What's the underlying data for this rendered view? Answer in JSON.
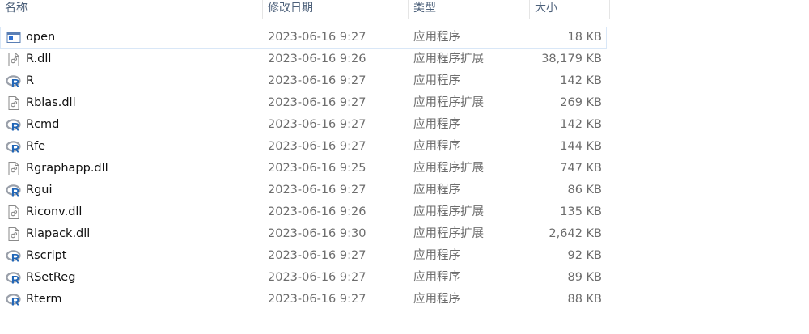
{
  "columns": {
    "name": "名称",
    "date": "修改日期",
    "type": "类型",
    "size": "大小"
  },
  "files": [
    {
      "name": "open",
      "date": "2023-06-16 9:27",
      "type": "应用程序",
      "size": "18 KB",
      "icon": "app-window-icon",
      "selected": true
    },
    {
      "name": "R.dll",
      "date": "2023-06-16 9:26",
      "type": "应用程序扩展",
      "size": "38,179 KB",
      "icon": "dll-file-icon"
    },
    {
      "name": "R",
      "date": "2023-06-16 9:27",
      "type": "应用程序",
      "size": "142 KB",
      "icon": "r-logo-icon"
    },
    {
      "name": "Rblas.dll",
      "date": "2023-06-16 9:27",
      "type": "应用程序扩展",
      "size": "269 KB",
      "icon": "dll-file-icon"
    },
    {
      "name": "Rcmd",
      "date": "2023-06-16 9:27",
      "type": "应用程序",
      "size": "142 KB",
      "icon": "r-logo-icon"
    },
    {
      "name": "Rfe",
      "date": "2023-06-16 9:27",
      "type": "应用程序",
      "size": "144 KB",
      "icon": "r-logo-icon"
    },
    {
      "name": "Rgraphapp.dll",
      "date": "2023-06-16 9:25",
      "type": "应用程序扩展",
      "size": "747 KB",
      "icon": "dll-file-icon"
    },
    {
      "name": "Rgui",
      "date": "2023-06-16 9:27",
      "type": "应用程序",
      "size": "86 KB",
      "icon": "r-logo-icon"
    },
    {
      "name": "Riconv.dll",
      "date": "2023-06-16 9:26",
      "type": "应用程序扩展",
      "size": "135 KB",
      "icon": "dll-file-icon"
    },
    {
      "name": "Rlapack.dll",
      "date": "2023-06-16 9:30",
      "type": "应用程序扩展",
      "size": "2,642 KB",
      "icon": "dll-file-icon"
    },
    {
      "name": "Rscript",
      "date": "2023-06-16 9:27",
      "type": "应用程序",
      "size": "92 KB",
      "icon": "r-logo-icon"
    },
    {
      "name": "RSetReg",
      "date": "2023-06-16 9:27",
      "type": "应用程序",
      "size": "89 KB",
      "icon": "r-logo-icon"
    },
    {
      "name": "Rterm",
      "date": "2023-06-16 9:27",
      "type": "应用程序",
      "size": "88 KB",
      "icon": "r-logo-icon"
    }
  ],
  "colors": {
    "header_text": "#4c607a",
    "r_logo_ring": "#9aa0aa",
    "r_logo_letter": "#1f65b7",
    "selection_border": "#d9e7f7"
  }
}
